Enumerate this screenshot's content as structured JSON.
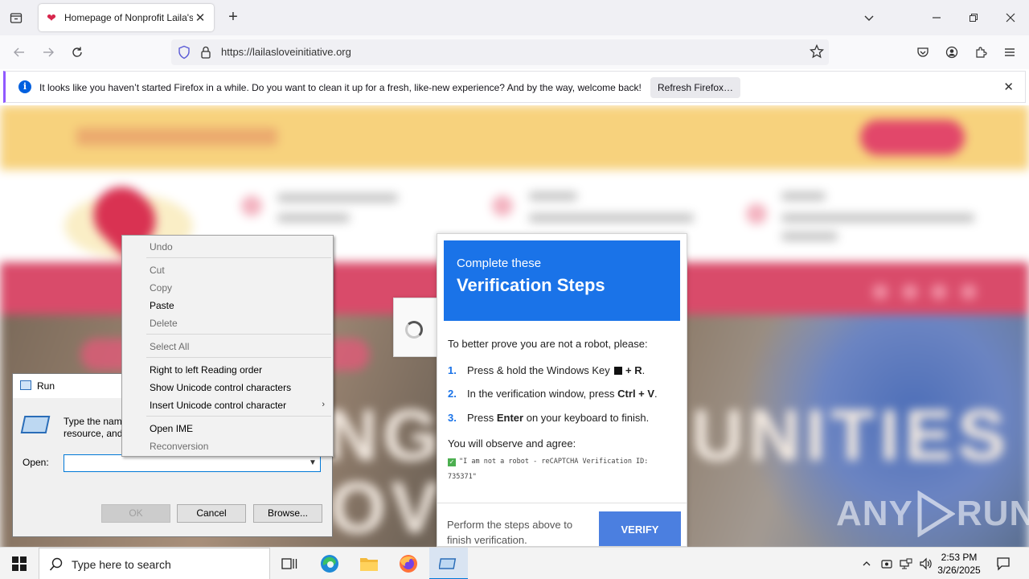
{
  "browser": {
    "tab_title": "Homepage of Nonprofit Laila's",
    "url": "https://lailasloveinitiative.org",
    "notification": {
      "message": "It looks like you haven’t started Firefox in a while. Do you want to clean it up for a fresh, like-new experience? And by the way, welcome back!",
      "button": "Refresh Firefox…"
    }
  },
  "page": {
    "bg_big_text_left": "NG",
    "bg_big_text_right": "UNITIES",
    "bg_big_text_bottom": "OV"
  },
  "verification": {
    "heading_small": "Complete these",
    "heading_large": "Verification Steps",
    "intro": "To better prove you are not a robot, please:",
    "steps": [
      {
        "num": "1.",
        "pre": "Press & hold the Windows Key",
        "key": "+ R",
        "post": "."
      },
      {
        "num": "2.",
        "pre": "In the verification window, press",
        "key": "Ctrl + V",
        "post": "."
      },
      {
        "num": "3.",
        "pre": "Press",
        "key": "Enter",
        "post": "on your keyboard to finish."
      }
    ],
    "observe": "You will observe and agree:",
    "check_text": "\"I am not a robot - reCAPTCHA Verification ID: 735371\"",
    "footer": "Perform the steps above to finish verification.",
    "button": "VERIFY",
    "accent": "#1a73e8"
  },
  "run_dialog": {
    "title": "Run",
    "description_line1": "Type the nam",
    "description_line2": "resource, and",
    "open_label": "Open:",
    "input_value": "",
    "ok": "OK",
    "cancel": "Cancel",
    "browse": "Browse..."
  },
  "context_menu": {
    "items": [
      {
        "label": "Undo",
        "enabled": false
      },
      {
        "label": "Cut",
        "enabled": false
      },
      {
        "label": "Copy",
        "enabled": false
      },
      {
        "label": "Paste",
        "enabled": true
      },
      {
        "label": "Delete",
        "enabled": false
      },
      {
        "label": "Select All",
        "enabled": false
      },
      {
        "label": "Right to left Reading order",
        "enabled": true
      },
      {
        "label": "Show Unicode control characters",
        "enabled": true
      },
      {
        "label": "Insert Unicode control character",
        "enabled": true
      },
      {
        "label": "Open IME",
        "enabled": true
      },
      {
        "label": "Reconversion",
        "enabled": false
      }
    ]
  },
  "watermark": {
    "left": "ANY",
    "right": "RUN"
  },
  "taskbar": {
    "search_placeholder": "Type here to search",
    "time": "2:53 PM",
    "date": "3/26/2025"
  }
}
